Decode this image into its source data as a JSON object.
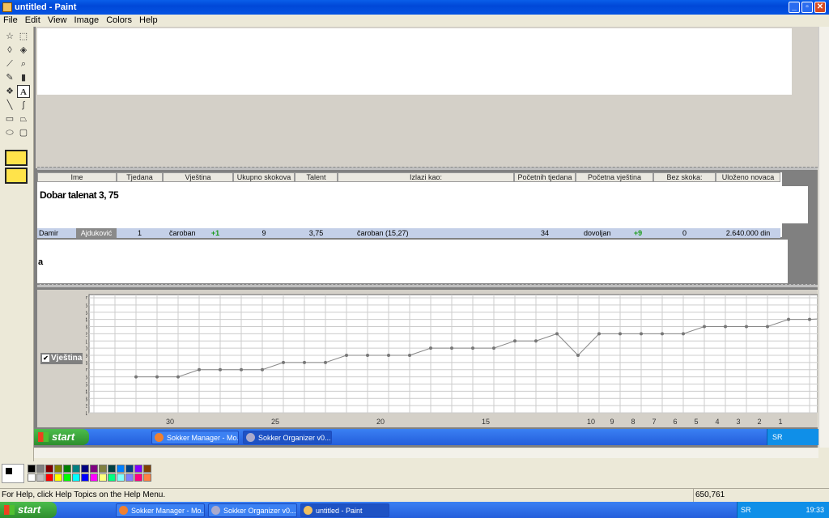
{
  "window": {
    "title": "untitled - Paint"
  },
  "menu": [
    "File",
    "Edit",
    "View",
    "Image",
    "Colors",
    "Help"
  ],
  "table": {
    "headers": [
      "Ime",
      "Tjedana",
      "Vještina",
      "Ukupno skokova",
      "Talent",
      "Izlazi kao:",
      "Početnih tjedana",
      "Početna vještina",
      "Bez skoka:",
      "Uloženo novaca"
    ],
    "selected_row": {
      "first_name": "Damir",
      "last_name": "Ajduković",
      "tjedana": "1",
      "vjestina": "čaroban",
      "vjestina_delta": "+1",
      "ukupno_skokova": "9",
      "talent": "3,75",
      "izlazi_kao": "čaroban (15,27)",
      "pocetnih_tjedana": "34",
      "pocetna_vjestina": "dovoljan",
      "pocetna_delta": "+9",
      "bez_skoka": "0",
      "ulozeno_novaca": "2.640.000 din"
    }
  },
  "overlay_text": {
    "main": "Dobar talenat 3, 75",
    "small": "a"
  },
  "chart_checkbox_label": "Vještina",
  "chart_data": {
    "type": "line",
    "x_labels": [
      "30",
      "25",
      "20",
      "15",
      "10",
      "9",
      "8",
      "7",
      "6",
      "5",
      "4",
      "3",
      "2",
      "1"
    ],
    "y_ticks": [
      "1",
      "2",
      "3",
      "4",
      "5",
      "6",
      "7",
      "8",
      "9",
      "10",
      "11",
      "12",
      "13",
      "14",
      "15",
      "16",
      "17"
    ],
    "ylim": [
      1,
      17
    ],
    "values": [
      6,
      6,
      6,
      7,
      7,
      7,
      7,
      8,
      8,
      8,
      9,
      9,
      9,
      9,
      10,
      10,
      10,
      10,
      11,
      11,
      12,
      9,
      12,
      12,
      12,
      12,
      12,
      13,
      13,
      13,
      13,
      14,
      14,
      14.2
    ],
    "grid": true
  },
  "inner_taskbar": {
    "start": "start",
    "buttons": [
      "Sokker Manager - Mo...",
      "Sokker Organizer v0...."
    ],
    "lang": "SR"
  },
  "status": {
    "help": "For Help, click Help Topics on the Help Menu.",
    "coords": "650,761"
  },
  "outer_taskbar": {
    "start": "start",
    "buttons": [
      "Sokker Manager - Mo...",
      "Sokker Organizer v0....",
      "untitled - Paint"
    ],
    "lang": "SR",
    "clock": "19:33"
  },
  "colors": {
    "palette": [
      "#000000",
      "#808080",
      "#800000",
      "#808000",
      "#008000",
      "#008080",
      "#000080",
      "#800080",
      "#808040",
      "#004040",
      "#0080ff",
      "#004080",
      "#8000ff",
      "#804000",
      "#ffffff",
      "#c0c0c0",
      "#ff0000",
      "#ffff00",
      "#00ff00",
      "#00ffff",
      "#0000ff",
      "#ff00ff",
      "#ffff80",
      "#00ff80",
      "#80ffff",
      "#8080ff",
      "#ff0080",
      "#ff8040"
    ]
  }
}
